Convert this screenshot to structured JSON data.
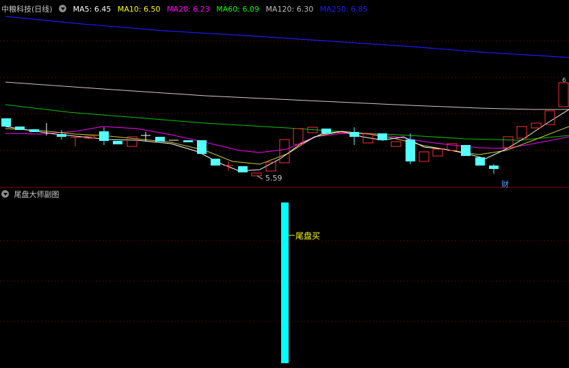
{
  "header": {
    "stock_title": "中粮科技(日线)",
    "ma": [
      {
        "label": "MA5:",
        "value": "6.45",
        "color": "#ffffff"
      },
      {
        "label": "MA10:",
        "value": "6.50",
        "color": "#ffff00"
      },
      {
        "label": "MA20:",
        "value": "6.23",
        "color": "#ff00ff"
      },
      {
        "label": "MA60:",
        "value": "6.09",
        "color": "#00ff00"
      },
      {
        "label": "MA120:",
        "value": "6.30",
        "color": "#c0c0c0"
      },
      {
        "label": "MA250:",
        "value": "6.85",
        "color": "#1c1cff"
      }
    ]
  },
  "main_chart": {
    "low_label": "5.59",
    "finance_marker": "财",
    "high_marker": "6"
  },
  "sub_chart": {
    "title": "尾盘大师副图",
    "signal_label": "尾盘买",
    "colors": {
      "bar": "#00ffff",
      "signal": "#ffff00"
    }
  },
  "colors": {
    "up": "#ff3232",
    "down": "#54ffff",
    "grid": "#5a0000"
  }
}
